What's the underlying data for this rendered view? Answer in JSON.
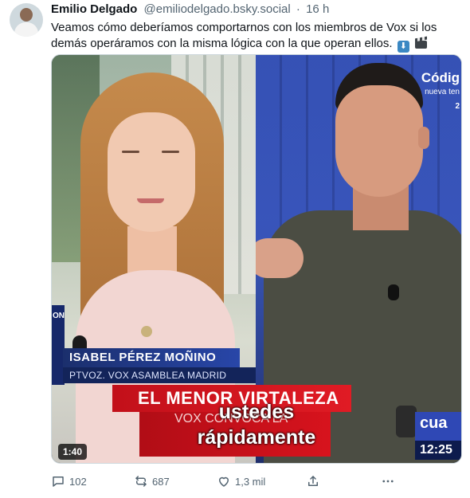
{
  "post": {
    "author_name": "Emilio Delgado",
    "author_handle": "@emiliodelgado.bsky.social",
    "separator": "·",
    "time_ago": "16 h",
    "text": "Veamos cómo deberíamos comportarnos con los miembros de Vox si los demás operáramos con la misma lógica con la que operan ellos.",
    "emoji_1": "⬇",
    "emoji_1_name": "down-arrow-emoji",
    "emoji_2_name": "clapper-board-emoji"
  },
  "video": {
    "duration": "1:40",
    "left_panel": {
      "side_label": "ON",
      "name_tag": "ISABEL PÉREZ MOÑINO",
      "role_tag": "PTVOZ. VOX ASAMBLEA MADRID"
    },
    "right_panel": {
      "logo": "Códig",
      "logo_sub": "nueva ten",
      "logo_num": "2",
      "channel": "cua",
      "clock": "12:25"
    },
    "headline": "EL MENOR VIRTALEZA",
    "subheadline": "VOX CONVOCA LA",
    "subtitle_line_1": "ustedes",
    "subtitle_line_2": "rápidamente"
  },
  "actions": {
    "replies": "102",
    "reposts": "687",
    "likes": "1,3 mil",
    "share_icon": "share-icon",
    "more_icon": "more-icon"
  },
  "colors": {
    "text_primary": "#0f1419",
    "text_secondary": "#536471",
    "border": "#cfd9de"
  }
}
